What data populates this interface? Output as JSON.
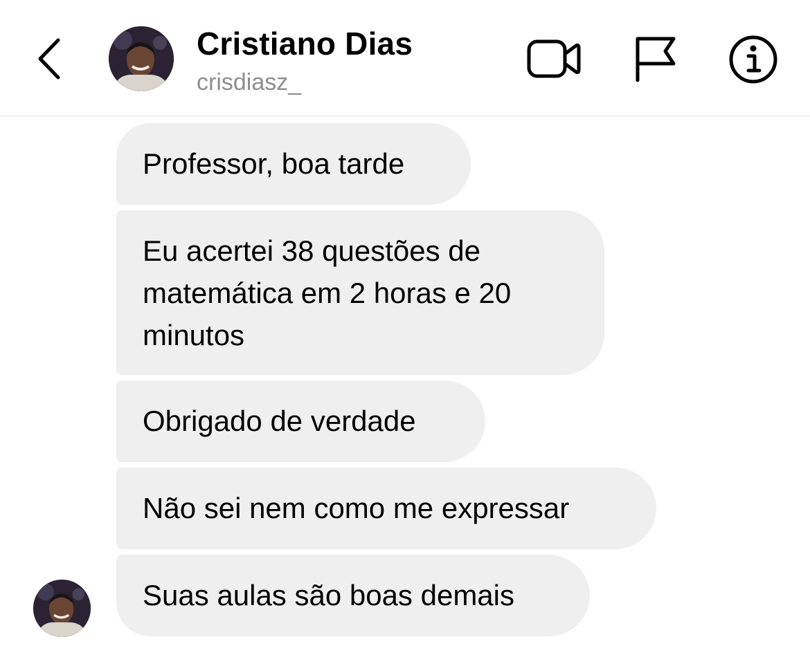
{
  "header": {
    "contact_name": "Cristiano Dias",
    "username": "crisdiasz_",
    "icons": [
      "chevron-left-icon",
      "video-camera-icon",
      "flag-icon",
      "info-icon"
    ]
  },
  "messages": [
    {
      "lines": [
        "Professor, boa tarde"
      ]
    },
    {
      "lines": [
        "Eu acertei 38 questões de",
        "matemática em 2 horas e 20",
        "minutos"
      ]
    },
    {
      "lines": [
        "Obrigado de verdade"
      ]
    },
    {
      "lines": [
        "Não sei nem como me expressar"
      ]
    },
    {
      "lines": [
        "Suas aulas são boas demais"
      ]
    }
  ],
  "colors": {
    "bubble_background": "#efefef",
    "username_gray": "#8e8e8e",
    "divider": "#e3e3e3"
  }
}
